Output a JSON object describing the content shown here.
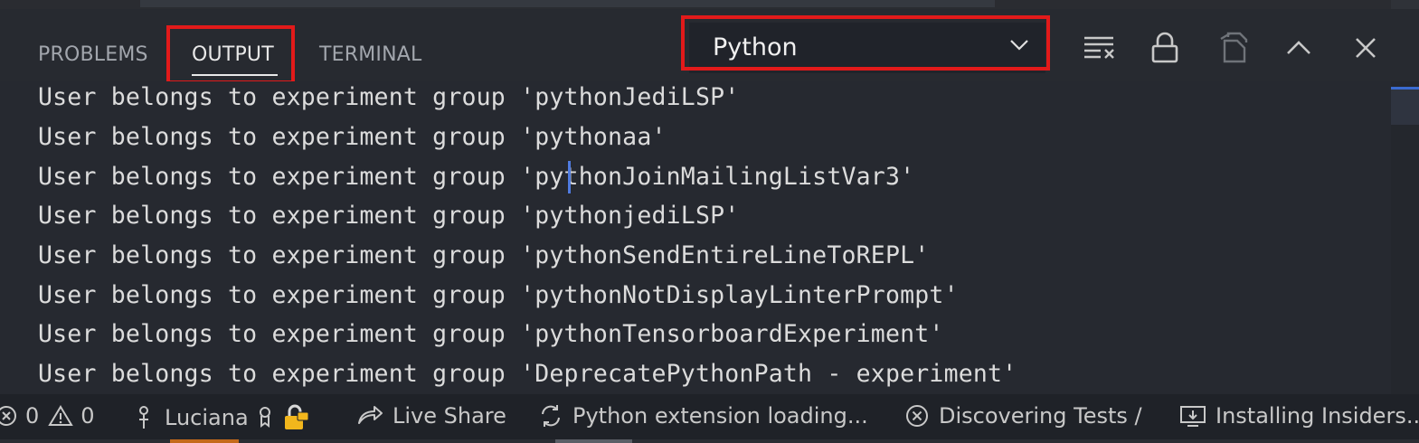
{
  "panel": {
    "tabs": [
      {
        "label": "PROBLEMS"
      },
      {
        "label": "OUTPUT"
      },
      {
        "label": "TERMINAL"
      }
    ],
    "channel_select": {
      "value": "Python"
    },
    "actions": {
      "clear": "clear-output-icon",
      "lock": "lock-scroll-icon",
      "open": "open-log-file-icon",
      "maximize": "chevron-up-icon",
      "close": "close-icon"
    }
  },
  "output_lines": [
    "User belongs to experiment group 'pythonJediLSP'",
    "User belongs to experiment group 'pythonaa'",
    "User belongs to experiment group 'pythonJoinMailingListVar3'",
    "User belongs to experiment group 'pythonjediLSP'",
    "User belongs to experiment group 'pythonSendEntireLineToREPL'",
    "User belongs to experiment group 'pythonNotDisplayLinterPrompt'",
    "User belongs to experiment group 'pythonTensorboardExperiment'",
    "User belongs to experiment group 'DeprecatePythonPath - experiment'"
  ],
  "statusbar": {
    "errors": "0",
    "warnings": "0",
    "user": "Luciana",
    "live_share": "Live Share",
    "python_status": "Python extension loading...",
    "tests_status": "Discovering Tests /",
    "install_status": "Installing Insiders..."
  },
  "colors": {
    "highlight_box": "#e21a1a",
    "cursor": "#4f7be0"
  }
}
